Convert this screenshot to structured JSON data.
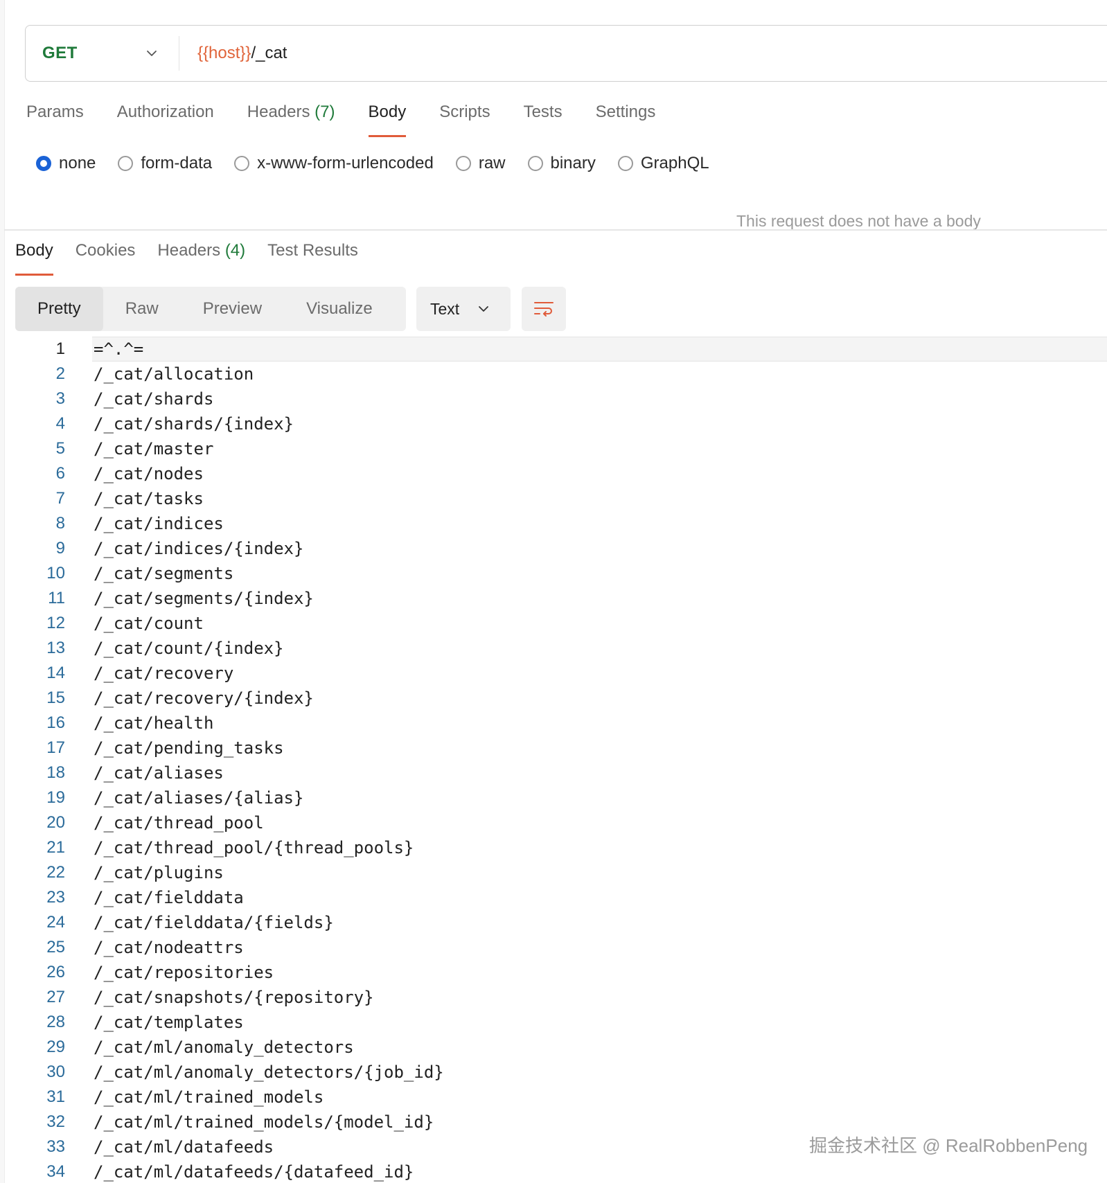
{
  "request": {
    "method": "GET",
    "url_variable": "{{host}}",
    "url_path": "/_cat"
  },
  "request_tabs": [
    {
      "label": "Params",
      "count": ""
    },
    {
      "label": "Authorization",
      "count": ""
    },
    {
      "label": "Headers",
      "count": "(7)"
    },
    {
      "label": "Body",
      "count": ""
    },
    {
      "label": "Scripts",
      "count": ""
    },
    {
      "label": "Tests",
      "count": ""
    },
    {
      "label": "Settings",
      "count": ""
    }
  ],
  "body_types": [
    "none",
    "form-data",
    "x-www-form-urlencoded",
    "raw",
    "binary",
    "GraphQL"
  ],
  "body_types_selected": "none",
  "no_body_message": "This request does not have a body",
  "response_tabs": [
    {
      "label": "Body",
      "count": ""
    },
    {
      "label": "Cookies",
      "count": ""
    },
    {
      "label": "Headers",
      "count": "(4)"
    },
    {
      "label": "Test Results",
      "count": ""
    }
  ],
  "view_modes": [
    "Pretty",
    "Raw",
    "Preview",
    "Visualize"
  ],
  "view_mode_selected": "Pretty",
  "format": "Text",
  "icons": {
    "method_dropdown": "chevron-down-icon",
    "format_dropdown": "chevron-down-icon",
    "wrap": "wrap-lines-icon"
  },
  "colors": {
    "method": "#1f7a3a",
    "variable": "#e0643a",
    "active_tab_underline": "#e05b3a",
    "radio_selected": "#1a62d6",
    "line_number": "#2b6b9a"
  },
  "response_lines": [
    "=^.^=",
    "/_cat/allocation",
    "/_cat/shards",
    "/_cat/shards/{index}",
    "/_cat/master",
    "/_cat/nodes",
    "/_cat/tasks",
    "/_cat/indices",
    "/_cat/indices/{index}",
    "/_cat/segments",
    "/_cat/segments/{index}",
    "/_cat/count",
    "/_cat/count/{index}",
    "/_cat/recovery",
    "/_cat/recovery/{index}",
    "/_cat/health",
    "/_cat/pending_tasks",
    "/_cat/aliases",
    "/_cat/aliases/{alias}",
    "/_cat/thread_pool",
    "/_cat/thread_pool/{thread_pools}",
    "/_cat/plugins",
    "/_cat/fielddata",
    "/_cat/fielddata/{fields}",
    "/_cat/nodeattrs",
    "/_cat/repositories",
    "/_cat/snapshots/{repository}",
    "/_cat/templates",
    "/_cat/ml/anomaly_detectors",
    "/_cat/ml/anomaly_detectors/{job_id}",
    "/_cat/ml/trained_models",
    "/_cat/ml/trained_models/{model_id}",
    "/_cat/ml/datafeeds",
    "/_cat/ml/datafeeds/{datafeed_id}"
  ],
  "watermark": "掘金技术社区 @ RealRobbenPeng"
}
